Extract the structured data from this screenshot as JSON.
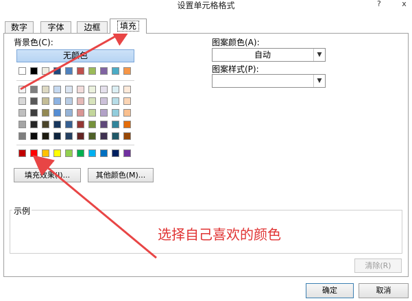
{
  "window": {
    "title": "设置单元格格式",
    "help": "?",
    "close": "x"
  },
  "tabs": [
    {
      "label": "数字"
    },
    {
      "label": "字体"
    },
    {
      "label": "边框"
    },
    {
      "label": "填充",
      "active": true
    }
  ],
  "fill": {
    "background_label": "背景色(C):",
    "no_color": "无颜色",
    "theme_top_row": [
      "#ffffff",
      "#000000",
      "#eeece1",
      "#1f497d",
      "#4f81bd",
      "#c0504d",
      "#9bbb59",
      "#8064a2",
      "#4bacc6",
      "#f79646"
    ],
    "theme_shades": [
      [
        "#f2f2f2",
        "#7f7f7f",
        "#ddd9c3",
        "#c6d9f0",
        "#dbe5f1",
        "#f2dcdb",
        "#ebf1dd",
        "#e5e0ec",
        "#dbeef3",
        "#fdeada"
      ],
      [
        "#d8d8d8",
        "#595959",
        "#c4bd97",
        "#8db3e2",
        "#b8cce4",
        "#e5b9b7",
        "#d7e3bc",
        "#ccc1d9",
        "#b7dde8",
        "#fbd5b5"
      ],
      [
        "#bfbfbf",
        "#3f3f3f",
        "#938953",
        "#548dd4",
        "#95b3d7",
        "#d99694",
        "#c3d69b",
        "#b2a2c7",
        "#92cddc",
        "#fac08f"
      ],
      [
        "#a5a5a5",
        "#262626",
        "#494429",
        "#17365d",
        "#366092",
        "#953734",
        "#76923c",
        "#5f497a",
        "#31859b",
        "#e36c09"
      ],
      [
        "#7f7f7f",
        "#0c0c0c",
        "#1d1b10",
        "#0f243e",
        "#244061",
        "#632423",
        "#4f6128",
        "#3f3151",
        "#205867",
        "#974806"
      ]
    ],
    "standard_colors": [
      "#c00000",
      "#ff0000",
      "#ffc000",
      "#ffff00",
      "#92d050",
      "#00b050",
      "#00b0f0",
      "#0070c0",
      "#002060",
      "#7030a0"
    ],
    "fill_effects_button": "填充效果(I)...",
    "more_colors_button": "其他颜色(M)..."
  },
  "pattern": {
    "color_label": "图案颜色(A):",
    "color_value": "自动",
    "style_label": "图案样式(P):",
    "style_value": ""
  },
  "sample": {
    "legend": "示例",
    "clear_button": "清除(R)"
  },
  "annotation": {
    "text": "选择自己喜欢的颜色",
    "color": "#e03333"
  },
  "footer": {
    "ok_button": "确定",
    "cancel_button": "取消"
  }
}
